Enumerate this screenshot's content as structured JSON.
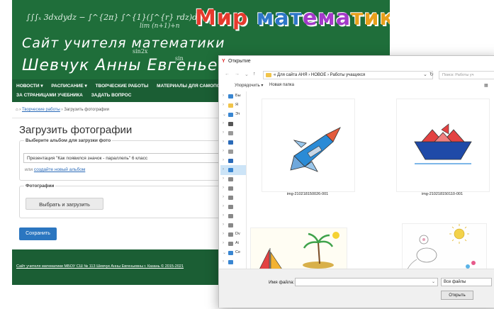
{
  "banner": {
    "logo_parts": [
      "Мир ",
      "мат",
      "ема",
      "тики"
    ],
    "title_line1": "Сайт учителя математики",
    "title_line2": "Шевчук Анны Евгенье",
    "formula": "∫∫∫ₓ 3dxdydz − ∫^{2π} ∫^{1}(∫^{r} rdz)dr dφ",
    "formula2": "lim (n+1)+n",
    "chalk1": "sin2x",
    "chalk2": "sin"
  },
  "nav": {
    "row1": [
      "НОВОСТИ ▾",
      "РАСПИСАНИЕ ▾",
      "ТВОРЧЕСКИЕ РАБОТЫ",
      "МАТЕРИАЛЫ ДЛЯ САМОПО"
    ],
    "row2": [
      "ЗА СТРАНИЦАМИ УЧЕБНИКА",
      "ЗАДАТЬ ВОПРОС"
    ]
  },
  "breadcrumb": {
    "home_icon": "home-icon",
    "sep": "›",
    "link": "Творческие работы",
    "current": "Загрузить фотографии"
  },
  "form": {
    "title": "Загрузить фотографии",
    "album_legend": "Выберите альбом для загрузки фото",
    "album_value": "Презентация \"Как появился значок - параллель\" 6 класс",
    "or_text": "или",
    "create_album_link": "создайте новый альбом",
    "photos_legend": "Фотографии",
    "upload_button": "Выбрать и загрузить",
    "save_button": "Сохранить"
  },
  "footer": {
    "text": "Сайт учителя математики МБОУ СШ № 113 Шевчук Анны Евгеньевны г. Казань © 2015-2021"
  },
  "dialog": {
    "title": "Открытие",
    "back_icon": "back-arrow-icon",
    "forward_icon": "forward-arrow-icon",
    "up_icon": "up-arrow-icon",
    "address": "« Для сайта АНЯ › НОВОЕ › Работы учащихся",
    "search_placeholder": "Поиск: Работы уч",
    "toolbar_organize": "Упорядочить ▾",
    "toolbar_new_folder": "Новая папка",
    "sidebar": [
      {
        "label": "Бы",
        "icon": "pin-icon",
        "color": "#3a86d1"
      },
      {
        "label": "Я",
        "icon": "folder-icon",
        "color": "#f1c44a"
      },
      {
        "label": "Эт",
        "icon": "computer-icon",
        "color": "#3a86d1"
      },
      {
        "label": "",
        "icon": "cube-icon",
        "color": "#555555"
      },
      {
        "label": "",
        "icon": "document-icon",
        "color": "#999999"
      },
      {
        "label": "",
        "icon": "download-icon",
        "color": "#2a6ab8"
      },
      {
        "label": "",
        "icon": "document-icon",
        "color": "#999999"
      },
      {
        "label": "",
        "icon": "music-icon",
        "color": "#2a6ab8"
      },
      {
        "label": "",
        "icon": "desktop-icon",
        "color": "#3a86d1"
      },
      {
        "label": "",
        "icon": "drive-icon",
        "color": "#888888"
      },
      {
        "label": "",
        "icon": "drive-icon",
        "color": "#888888"
      },
      {
        "label": "",
        "icon": "drive-icon",
        "color": "#888888"
      },
      {
        "label": "",
        "icon": "drive-icon",
        "color": "#888888"
      },
      {
        "label": "",
        "icon": "drive-icon",
        "color": "#888888"
      },
      {
        "label": "",
        "icon": "drive-icon",
        "color": "#888888"
      },
      {
        "label": "Dv",
        "icon": "drive-icon",
        "color": "#888888"
      },
      {
        "label": "Ai",
        "icon": "drive-icon",
        "color": "#888888"
      },
      {
        "label": "Се",
        "icon": "network-icon",
        "color": "#3a86d1"
      },
      {
        "label": "",
        "icon": "monitor-icon",
        "color": "#3a86d1"
      }
    ],
    "files": [
      {
        "name": "img-210218150026-001"
      },
      {
        "name": "img-210218150110-001"
      },
      {
        "name": ""
      },
      {
        "name": ""
      }
    ],
    "filename_label": "Имя файла:",
    "filetype_value": "Все файлы",
    "open_button": "Открыть"
  }
}
